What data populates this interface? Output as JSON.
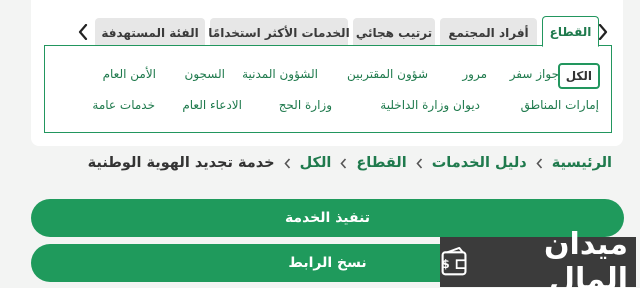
{
  "filter": {
    "tabs": [
      {
        "label": "القطاع",
        "active": true
      },
      {
        "label": "أفراد المجتمع",
        "active": false
      },
      {
        "label": "ترتيب هجائي",
        "active": false
      },
      {
        "label": "الخدمات الأكثر استخدامًا",
        "active": false
      },
      {
        "label": "الفئة المستهدفة",
        "active": false
      }
    ],
    "next_icon": "chevron-right-icon",
    "prev_icon": "chevron-left-icon",
    "chips_row1": [
      "الكل",
      "جواز سفر",
      "مرور",
      "شؤون المقتربين",
      "الشؤون المدنية",
      "السجون",
      "الأمن العام"
    ],
    "chips_row2": [
      "إمارات المناطق",
      "ديوان وزارة الداخلية",
      "وزارة الحج",
      "الادعاء العام",
      "خدمات عامة"
    ],
    "selected_chip": "الكل"
  },
  "breadcrumb": {
    "items": [
      "الرئيسية",
      "دليل الخدمات",
      "القطاع",
      "الكل"
    ],
    "current": "خدمة تجديد الهوية الوطنية"
  },
  "actions": {
    "execute_label": "تنفيذ الخدمة",
    "copy_label": "نسخ الرابط"
  },
  "watermark": {
    "text": "ميدان المال",
    "icon": "wallet-money-icon"
  },
  "colors": {
    "accent": "#1f9a5c",
    "accent_dark": "#1f7a4d",
    "tab_inactive": "#e7e7e7",
    "watermark_bg": "#3b3b3b"
  }
}
